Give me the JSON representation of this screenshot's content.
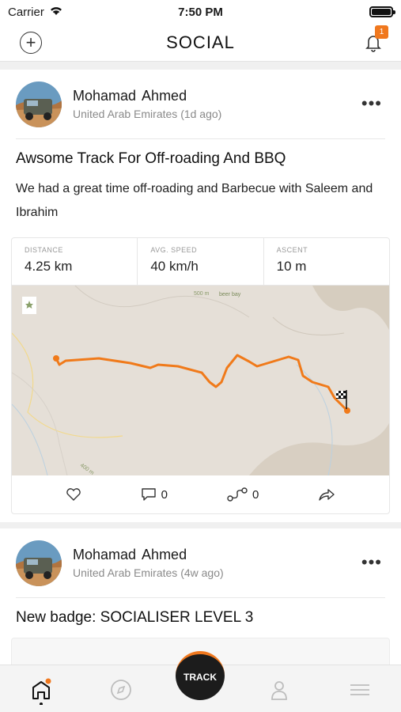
{
  "status_bar": {
    "carrier": "Carrier",
    "time": "7:50 PM",
    "battery_level": 1.0
  },
  "header": {
    "title": "SOCIAL",
    "notification_count": "1"
  },
  "posts": [
    {
      "author": "Mohamad  Ahmed",
      "location": "United Arab Emirates",
      "time_ago": "(1d ago)",
      "title": "Awsome Track For Off-roading And BBQ",
      "body": "We had a great time off-roading and Barbecue with Saleem and Ibrahim",
      "stats": [
        {
          "label": "DISTANCE",
          "value": "4.25 km"
        },
        {
          "label": "AVG. SPEED",
          "value": "40 km/h"
        },
        {
          "label": "ASCENT",
          "value": "10 m"
        }
      ],
      "map_labels": {
        "peak": "500 m",
        "place": "beer bay",
        "contour": "400 m"
      },
      "comments": "0",
      "shares": "0"
    },
    {
      "author": "Mohamad  Ahmed",
      "location": "United Arab Emirates",
      "time_ago": "(4w ago)",
      "title": "New badge: SOCIALISER LEVEL 3"
    }
  ],
  "tabbar": {
    "track_label": "TRACK"
  },
  "colors": {
    "accent": "#f0781e",
    "route": "#f07a1a",
    "map_bg": "#e5dfd7"
  }
}
